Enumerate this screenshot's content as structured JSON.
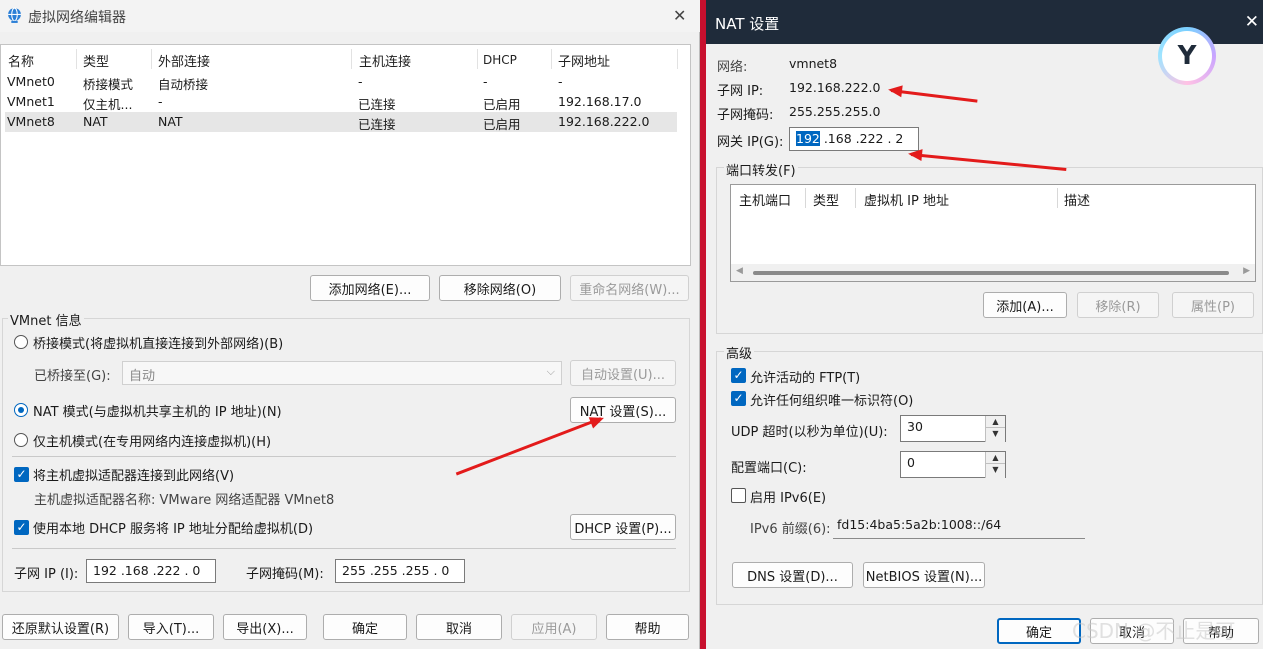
{
  "left_window": {
    "title": "虚拟网络编辑器",
    "close_glyph": "✕",
    "table": {
      "headers": [
        "名称",
        "类型",
        "外部连接",
        "主机连接",
        "DHCP",
        "子网地址"
      ],
      "rows": [
        [
          "VMnet0",
          "桥接模式",
          "自动桥接",
          "-",
          "-",
          "-"
        ],
        [
          "VMnet1",
          "仅主机...",
          "-",
          "已连接",
          "已启用",
          "192.168.17.0"
        ],
        [
          "VMnet8",
          "NAT",
          "NAT",
          "已连接",
          "已启用",
          "192.168.222.0"
        ]
      ]
    },
    "buttons": {
      "add_network": "添加网络(E)...",
      "remove_network": "移除网络(O)",
      "rename_network": "重命名网络(W)..."
    },
    "vmnet_info": {
      "group_label": "VMnet 信息",
      "bridged_label": "桥接模式(将虚拟机直接连接到外部网络)(B)",
      "bridged_to_label": "已桥接至(G):",
      "bridged_to_value": "自动",
      "auto_settings": "自动设置(U)...",
      "nat_label": "NAT 模式(与虚拟机共享主机的 IP 地址)(N)",
      "nat_settings": "NAT 设置(S)...",
      "hostonly_label": "仅主机模式(在专用网络内连接虚拟机)(H)",
      "connect_adapter_label": "将主机虚拟适配器连接到此网络(V)",
      "adapter_name_label": "主机虚拟适配器名称: VMware 网络适配器 VMnet8",
      "dhcp_label": "使用本地 DHCP 服务将 IP 地址分配给虚拟机(D)",
      "dhcp_settings": "DHCP 设置(P)...",
      "subnet_ip_label": "子网 IP (I):",
      "subnet_ip_value": "192 .168 .222 .  0",
      "subnet_mask_label": "子网掩码(M):",
      "subnet_mask_value": "255 .255 .255 .  0"
    },
    "footer": {
      "restore": "还原默认设置(R)",
      "import": "导入(T)...",
      "export": "导出(X)...",
      "ok": "确定",
      "cancel": "取消",
      "apply": "应用(A)",
      "help": "帮助"
    }
  },
  "nat_window": {
    "title": "NAT 设置",
    "close_glyph": "✕",
    "network_label": "网络:",
    "network_value": "vmnet8",
    "subnet_ip_label": "子网 IP:",
    "subnet_ip_value": "192.168.222.0",
    "subnet_mask_label": "子网掩码:",
    "subnet_mask_value": "255.255.255.0",
    "gateway_label": "网关 IP(G):",
    "gateway_first_octet": "192",
    "gateway_rest": " .168 .222 .  2",
    "port_forward_label": "端口转发(F)",
    "port_table_headers": [
      "主机端口",
      "类型",
      "虚拟机 IP 地址",
      "描述"
    ],
    "port_buttons": {
      "add": "添加(A)...",
      "remove": "移除(R)",
      "properties": "属性(P)"
    },
    "advanced_label": "高级",
    "allow_ftp_label": "允许活动的 FTP(T)",
    "allow_org_id_label": "允许任何组织唯一标识符(O)",
    "udp_timeout_label": "UDP 超时(以秒为单位)(U):",
    "udp_timeout_value": "30",
    "config_port_label": "配置端口(C):",
    "config_port_value": "0",
    "enable_ipv6_label": "启用 IPv6(E)",
    "ipv6_prefix_label": "IPv6 前缀(6):",
    "ipv6_prefix_value": "fd15:4ba5:5a2b:1008::/64",
    "dns_settings": "DNS 设置(D)...",
    "netbios_settings": "NetBIOS 设置(N)...",
    "ok": "确定",
    "cancel": "取消",
    "help": "帮助"
  },
  "overlay": {
    "logo_glyph": "Y",
    "watermark": "CSDN @不止是可"
  },
  "colors": {
    "accent": "#0067c0",
    "annotation_arrow": "#e31b1b",
    "nat_titlebar": "#1f2b3a"
  }
}
